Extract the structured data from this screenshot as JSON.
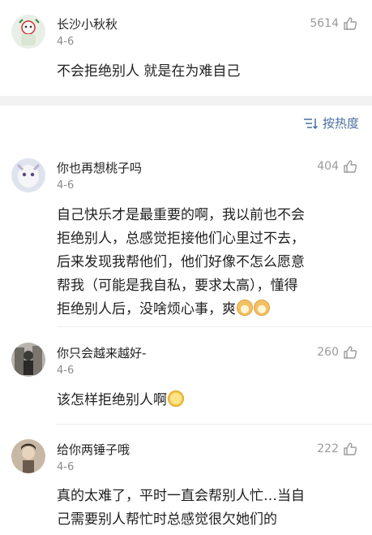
{
  "comments_top": {
    "name": "长沙小秋秋",
    "date": "4-6",
    "likes": "5614",
    "text": "不会拒绝别人 就是在为难自己"
  },
  "sort": {
    "label": "按热度",
    "icon": "sort-icon"
  },
  "comments": [
    {
      "name": "你也再想桃子吗",
      "date": "4-6",
      "likes": "404",
      "lines": [
        "自己快乐才是最重要的啊，我以前也不会",
        "拒绝别人，总感觉拒接他们心里过不去，",
        "后来发现我帮他们，他们好像不怎么愿意",
        "帮我（可能是我自私，要求太高），懂得",
        "拒绝别人后，没啥烦心事，爽"
      ],
      "emojis": [
        "shiba-emoji",
        "shiba-emoji"
      ]
    },
    {
      "name": "你只会越来越好-",
      "date": "4-6",
      "likes": "260",
      "lines": [
        "该怎样拒绝别人啊"
      ],
      "emojis": [
        "smile-emoji"
      ]
    },
    {
      "name": "给你两锤子哦",
      "date": "4-6",
      "likes": "222",
      "lines": [
        "真的太难了，平时一直会帮别人忙…当自",
        "己需要别人帮忙时总感觉很欠她们的"
      ]
    }
  ],
  "colors": {
    "link": "#4a6fa0",
    "meta": "#8a8a8a",
    "divider": "#f2f2f2"
  }
}
